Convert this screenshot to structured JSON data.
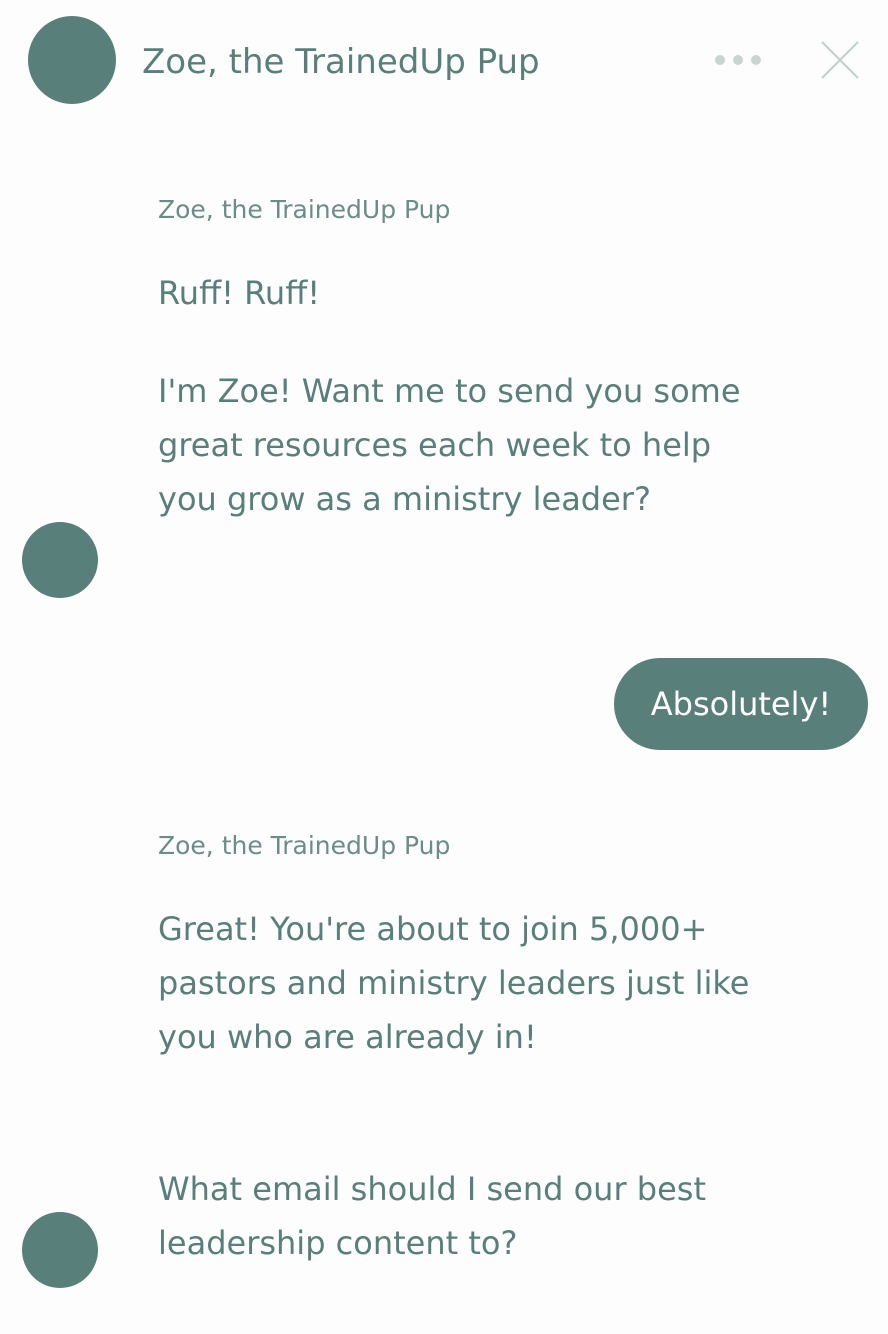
{
  "header": {
    "title": "Zoe, the TrainedUp Pup",
    "menu_icon": "more-horizontal-icon",
    "close_icon": "close-icon"
  },
  "messages": [
    {
      "sender": "Zoe, the TrainedUp Pup",
      "lines": [
        "Ruff! Ruff!",
        "I'm Zoe! Want me to send you some",
        "great resources each week to help",
        "you grow as a ministry leader?"
      ]
    },
    {
      "reply": "Absolutely!"
    },
    {
      "sender": "Zoe, the TrainedUp Pup",
      "lines": [
        "Great! You're about to join 5,000+",
        "pastors and ministry leaders just like",
        "you who are already in!",
        "What email should I send our best",
        "leadership content to?"
      ]
    }
  ],
  "colors": {
    "accent": "#587f79",
    "background": "#fdfdfd",
    "muted_icon": "#c9d3d1"
  }
}
